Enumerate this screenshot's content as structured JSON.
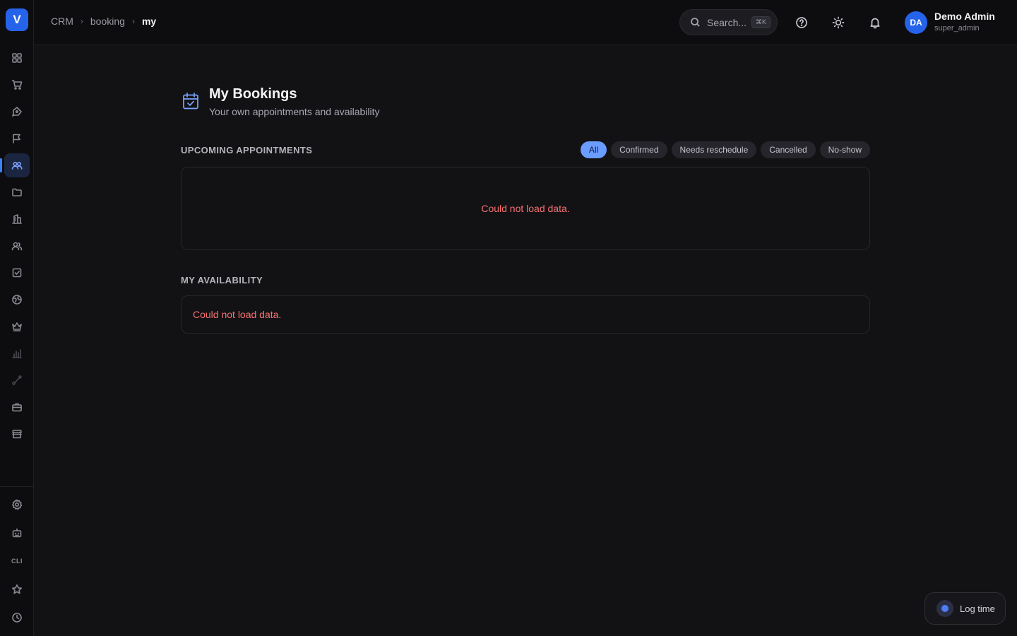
{
  "logo": {
    "letter": "V"
  },
  "breadcrumb": {
    "items": [
      "CRM",
      "booking"
    ],
    "current": "my"
  },
  "search": {
    "placeholder": "Search...",
    "shortcut": "⌘K"
  },
  "user": {
    "initials": "DA",
    "name": "Demo Admin",
    "role": "super_admin"
  },
  "page": {
    "title": "My Bookings",
    "subtitle": "Your own appointments and availability"
  },
  "appointments": {
    "section_title": "UPCOMING APPOINTMENTS",
    "filters": [
      "All",
      "Confirmed",
      "Needs reschedule",
      "Cancelled",
      "No-show"
    ],
    "active_filter": "All",
    "error": "Could not load data."
  },
  "availability": {
    "section_title": "MY AVAILABILITY",
    "error": "Could not load data."
  },
  "sidebar": {
    "bottom": {
      "cli_label": "CLI"
    }
  },
  "log_time": {
    "label": "Log time"
  },
  "colors": {
    "accent": "#2563eb",
    "active_chip": "#6b9cff",
    "error": "#f87171"
  }
}
